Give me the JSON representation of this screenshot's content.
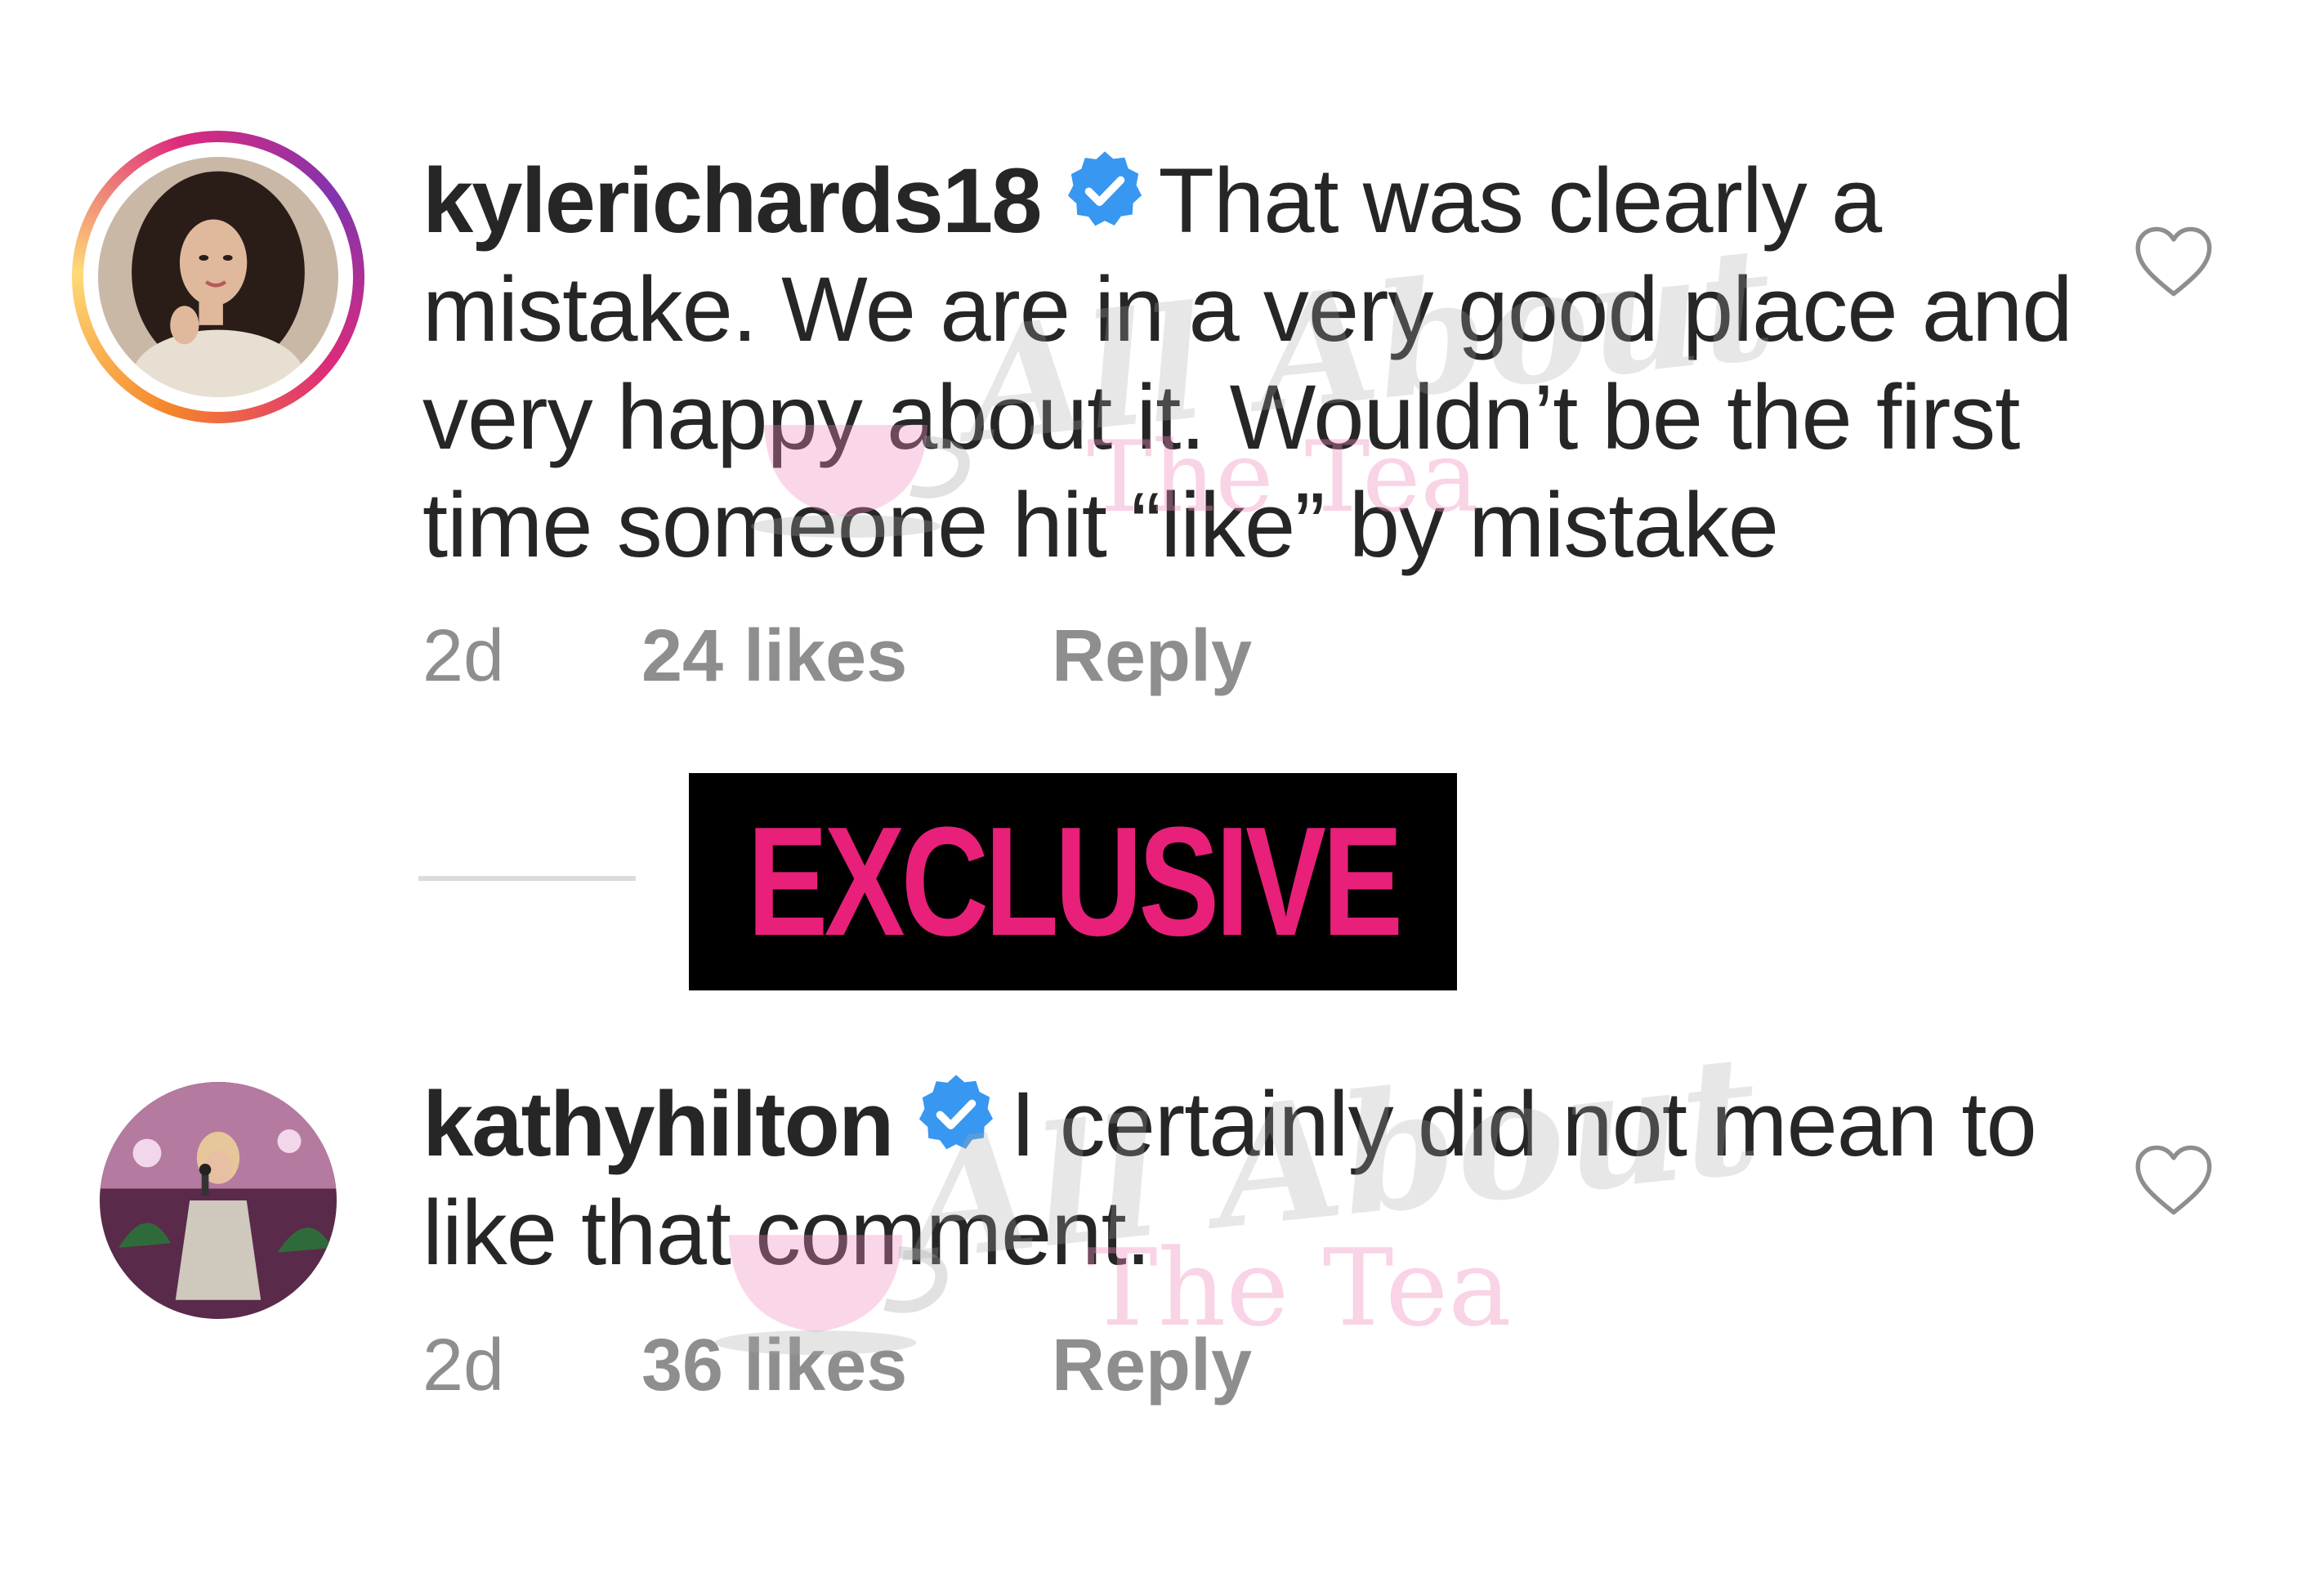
{
  "comments": [
    {
      "username": "kylerichards18",
      "verified": true,
      "text": "That was clearly a mistake. We are in a very good place and very happy about it. Wouldn’t be the first time someone hit “like” by mistake",
      "time": "2d",
      "likes": "24 likes",
      "reply_label": "Reply",
      "avatar_icon": "profile-photo-woman-dark-hair",
      "has_story_ring": true
    },
    {
      "username": "kathyhilton",
      "verified": true,
      "text": "I certainly did not mean to like that comment.",
      "time": "2d",
      "likes": "36 likes",
      "reply_label": "Reply",
      "avatar_icon": "profile-photo-woman-microphone",
      "has_story_ring": false
    }
  ],
  "banner": {
    "label": "EXCLUSIVE",
    "text_color": "#e8207a",
    "background": "#000000"
  },
  "watermark": {
    "line1": "All About",
    "line2": "The Tea"
  },
  "colors": {
    "text": "#262626",
    "meta": "#8e8e8e",
    "verified_badge": "#3897f0",
    "divider": "#dbdbdb"
  },
  "icons": {
    "like": "heart-outline-icon",
    "verified": "verified-badge-icon"
  }
}
